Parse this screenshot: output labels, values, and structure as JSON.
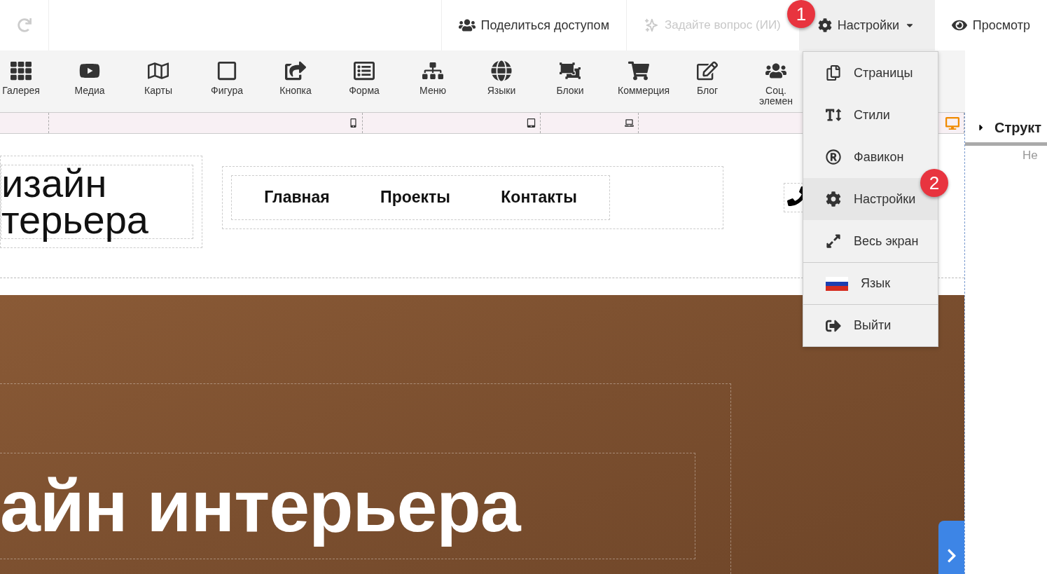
{
  "topbar": {
    "share": "Поделиться доступом",
    "ask_ai": {
      "placeholder": "Задайте вопрос (ИИ)",
      "disabled": true
    },
    "settings": {
      "label": "Настройки",
      "expanded": true
    },
    "preview": "Просмотр"
  },
  "toolbar": [
    {
      "label": "Галерея"
    },
    {
      "label": "Медиа"
    },
    {
      "label": "Карты"
    },
    {
      "label": "Фигура"
    },
    {
      "label": "Кнопка"
    },
    {
      "label": "Форма"
    },
    {
      "label": "Меню"
    },
    {
      "label": "Языки"
    },
    {
      "label": "Блоки"
    },
    {
      "label": "Коммерция"
    },
    {
      "label": "Блог"
    },
    {
      "label": "Соц. элемен"
    }
  ],
  "breakpoints": [
    {
      "selected": false
    },
    {
      "selected": false
    },
    {
      "selected": false
    },
    {
      "selected": true
    }
  ],
  "settings_menu": [
    {
      "label": "Страницы",
      "selected": false
    },
    {
      "label": "Стили",
      "selected": false
    },
    {
      "label": "Фавикон",
      "selected": false
    },
    {
      "label": "Настройки",
      "selected": true
    },
    {
      "label": "Весь экран",
      "selected": false
    },
    {
      "label": "Язык",
      "selected": false
    },
    {
      "label": "Выйти",
      "selected": false
    }
  ],
  "site_header": {
    "logo": [
      "изайн",
      "терьера"
    ],
    "nav": [
      "Главная",
      "Проекты",
      "Контакты"
    ]
  },
  "hero": {
    "title": "айн интерьера"
  },
  "structure_panel": {
    "title": "Структ",
    "note": "Не"
  },
  "annotations": [
    {
      "label": "1"
    },
    {
      "label": "2"
    }
  ]
}
